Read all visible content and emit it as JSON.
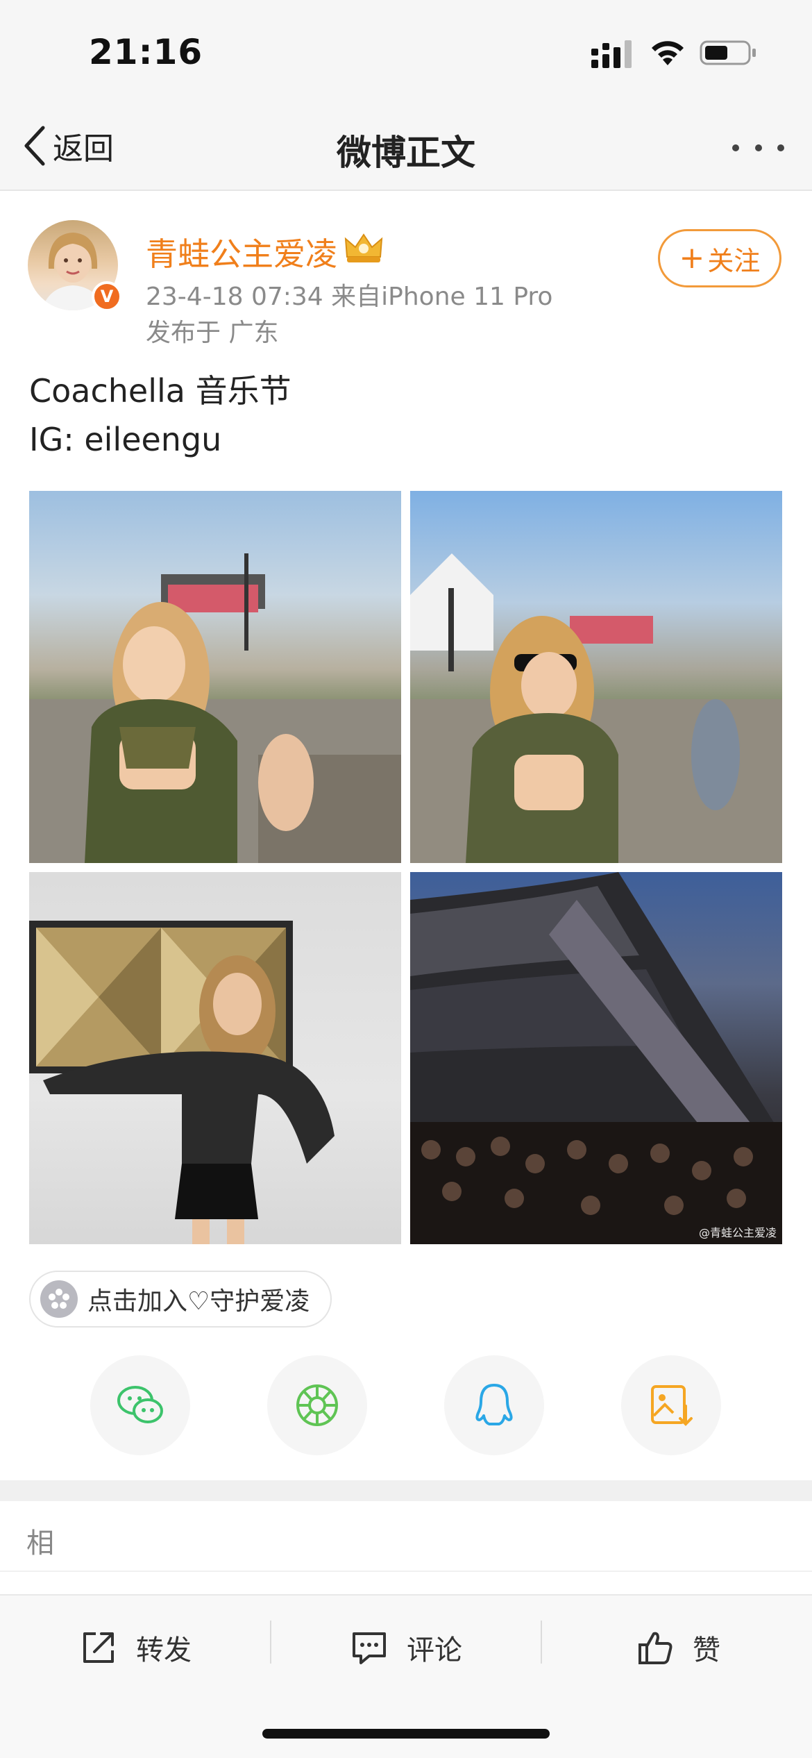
{
  "status_bar": {
    "time": "21:16"
  },
  "nav": {
    "back_label": "返回",
    "title": "微博正文"
  },
  "author": {
    "name": "青蛙公主爱凌",
    "verified_badge": "V",
    "meta": "23-4-18 07:34  来自iPhone 11 Pro",
    "location": "发布于 广东",
    "follow_label": "关注",
    "follow_plus": "+"
  },
  "post": {
    "line1": "Coachella 音乐节",
    "line2": "IG: eileengu",
    "watermark": "@青蛙公主爱凌"
  },
  "topic_chip": {
    "label": "点击加入♡守护爱凌"
  },
  "share": {
    "items": [
      "wechat-icon",
      "moments-icon",
      "qq-icon",
      "save-image-icon"
    ]
  },
  "related": {
    "label": "相"
  },
  "toolbar": {
    "repost_label": "转发",
    "comment_label": "评论",
    "like_label": "赞"
  },
  "colors": {
    "accent_orange": "#f07f1b",
    "wechat_green": "#3cc36b",
    "moments_green": "#5fc454",
    "qq_blue": "#2aa7e6",
    "save_orange": "#f5a623"
  }
}
